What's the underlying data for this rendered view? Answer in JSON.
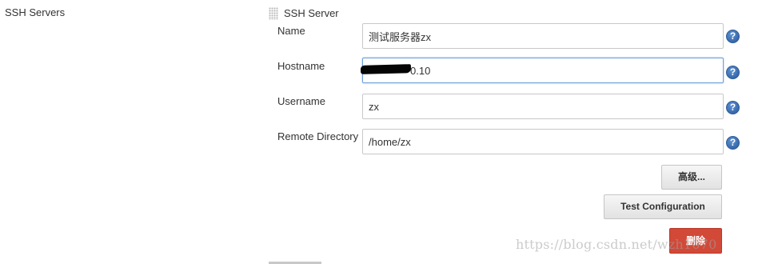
{
  "section": {
    "label": "SSH Servers"
  },
  "server": {
    "title": "SSH Server",
    "fields": [
      {
        "label": "Name",
        "value": "测试服务器zx"
      },
      {
        "label": "Hostname",
        "value": "0.10"
      },
      {
        "label": "Username",
        "value": "zx"
      },
      {
        "label": "Remote Directory",
        "value": "/home/zx"
      }
    ],
    "help_icon": "?"
  },
  "buttons": {
    "advanced": "高级...",
    "test_configuration": "Test Configuration",
    "delete": "删除"
  },
  "watermark": "https://blog.csdn.net/wzh1070",
  "colors": {
    "delete_button": "#d24938",
    "help_icon": "#3a6fb5",
    "focus_border": "#6e9fd8"
  }
}
